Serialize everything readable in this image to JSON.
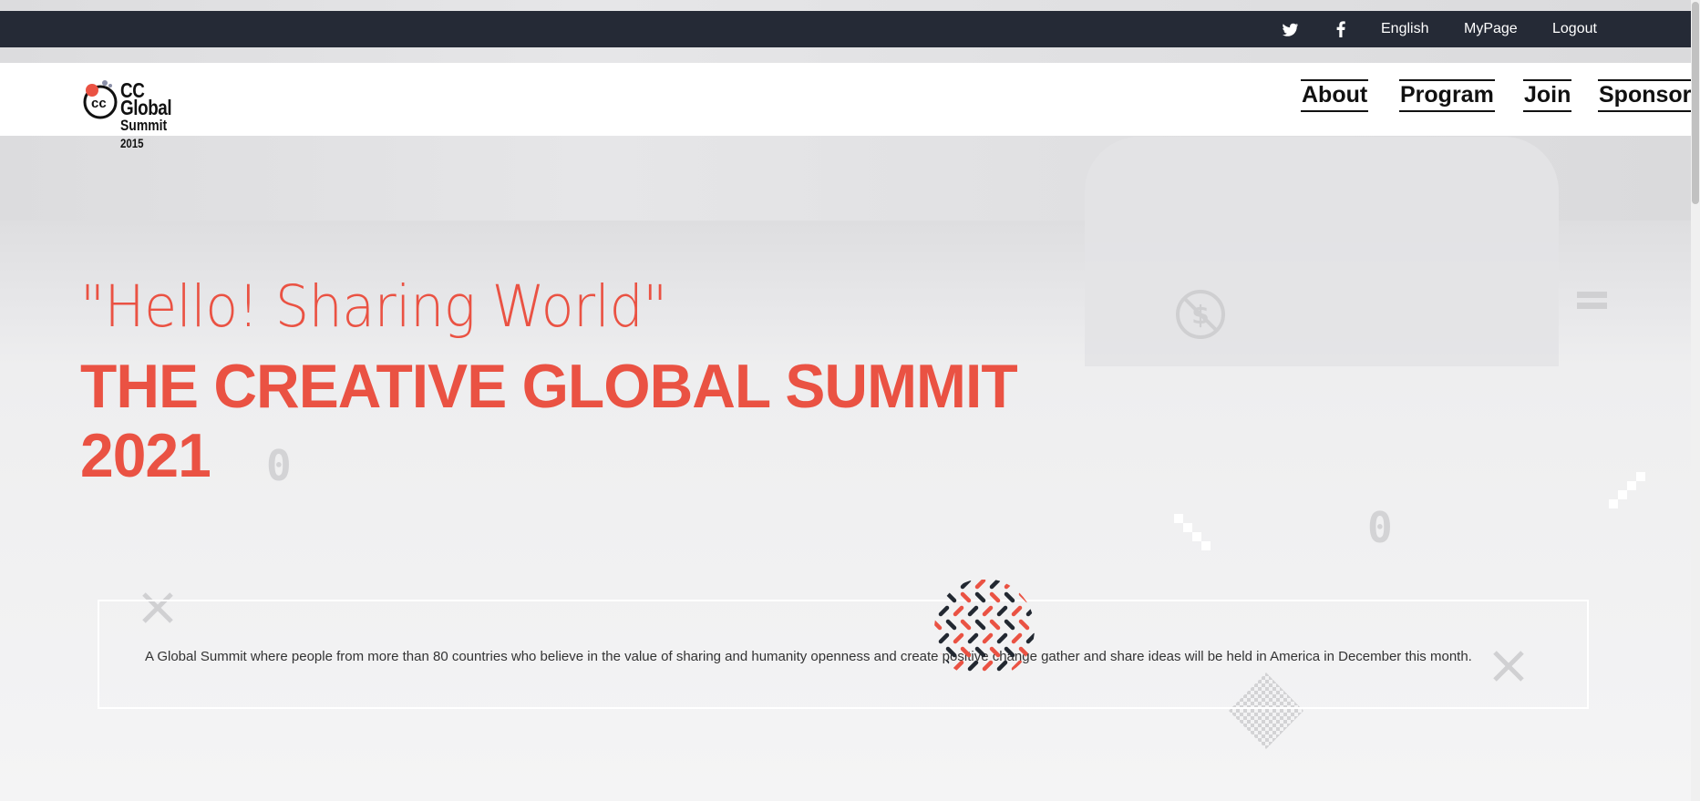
{
  "topbar": {
    "social": {
      "twitter_icon": "twitter-icon",
      "facebook_icon": "facebook-icon"
    },
    "language": "English",
    "mypage": "MyPage",
    "logout": "Logout"
  },
  "header": {
    "logo": {
      "mark": "CC",
      "line1": "CC Global",
      "line2": "Summit",
      "year": "2015"
    },
    "nav": [
      {
        "label": "About"
      },
      {
        "label": "Program"
      },
      {
        "label": "Join"
      },
      {
        "label": "Sponsor"
      }
    ]
  },
  "hero": {
    "tagline": "\"Hello! Sharing World\"",
    "headline_line1": "THE CREATIVE GLOBAL SUMMIT",
    "headline_line2": "2021",
    "description": "A Global Summit where people from more than 80 countries who believe in the value of sharing and humanity openness and create positive change gather and share ideas will be held in America in December this month."
  },
  "decorations": {
    "zero_glyph": "0",
    "dollar_icon": "no-dollar-icon",
    "equals_icon": "equals-icon"
  },
  "colors": {
    "accent": "#ea5243",
    "topbar_bg": "#252a36",
    "text_dark": "#111111"
  }
}
